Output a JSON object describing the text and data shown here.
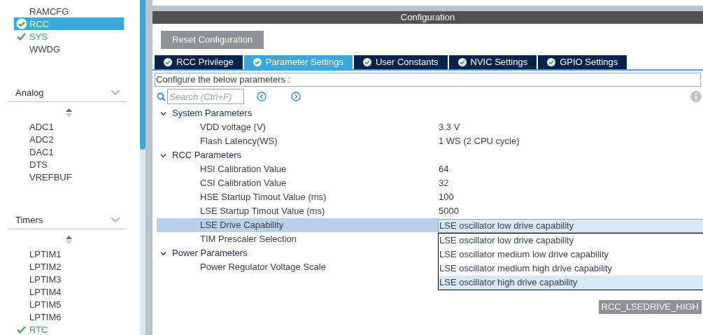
{
  "sidebar": {
    "groups": [
      {
        "items": [
          {
            "label": "RAMCFG",
            "selected": false,
            "checked": false
          },
          {
            "label": "RCC",
            "selected": true,
            "checked": true
          },
          {
            "label": "SYS",
            "selected": false,
            "checked": true
          },
          {
            "label": "WWDG",
            "selected": false,
            "checked": false
          }
        ]
      },
      {
        "title": "Analog",
        "items": [
          {
            "label": "ADC1",
            "selected": false,
            "checked": false
          },
          {
            "label": "ADC2",
            "selected": false,
            "checked": false
          },
          {
            "label": "DAC1",
            "selected": false,
            "checked": false
          },
          {
            "label": "DTS",
            "selected": false,
            "checked": false
          },
          {
            "label": "VREFBUF",
            "selected": false,
            "checked": false
          }
        ]
      },
      {
        "title": "Timers",
        "items": [
          {
            "label": "LPTIM1",
            "selected": false,
            "checked": false
          },
          {
            "label": "LPTIM2",
            "selected": false,
            "checked": false
          },
          {
            "label": "LPTIM3",
            "selected": false,
            "checked": false
          },
          {
            "label": "LPTIM4",
            "selected": false,
            "checked": false
          },
          {
            "label": "LPTIM5",
            "selected": false,
            "checked": false
          },
          {
            "label": "LPTIM6",
            "selected": false,
            "checked": false
          },
          {
            "label": "RTC",
            "selected": false,
            "checked": true
          }
        ]
      }
    ]
  },
  "panel": {
    "title": "Configuration",
    "reset_button": "Reset Configuration",
    "tabs": [
      {
        "label": "RCC Privilege",
        "selected": false
      },
      {
        "label": "Parameter Settings",
        "selected": true
      },
      {
        "label": "User Constants",
        "selected": false
      },
      {
        "label": "NVIC Settings",
        "selected": false
      },
      {
        "label": "GPIO Settings",
        "selected": false
      }
    ],
    "hint": "Configure the below parameters :",
    "search": {
      "placeholder": "Search (Ctrl+F)"
    },
    "tree": [
      {
        "label": "System Parameters",
        "expanded": true,
        "children": [
          {
            "name": "VDD voltage (V)",
            "value": "3.3 V",
            "selected": false
          },
          {
            "name": "Flash Latency(WS)",
            "value": "1 WS (2 CPU cycle)",
            "selected": false
          }
        ]
      },
      {
        "label": "RCC Parameters",
        "expanded": true,
        "children": [
          {
            "name": "HSI Calibration Value",
            "value": "64",
            "selected": false
          },
          {
            "name": "CSI Calibration Value",
            "value": "32",
            "selected": false
          },
          {
            "name": "HSE Startup Timout Value (ms)",
            "value": "100",
            "selected": false
          },
          {
            "name": "LSE Startup Timout Value (ms)",
            "value": "5000",
            "selected": false
          },
          {
            "name": "LSE Drive Capability",
            "selected": true
          },
          {
            "name": "TIM Prescaler Selection",
            "selected": false
          }
        ]
      },
      {
        "label": "Power Parameters",
        "expanded": true,
        "children": [
          {
            "name": "Power Regulator Voltage Scale",
            "selected": false
          }
        ]
      }
    ],
    "dropdown": {
      "value": "LSE oscillator low drive capability",
      "options": [
        {
          "label": "LSE oscillator low drive capability",
          "highlighted": false
        },
        {
          "label": "LSE oscillator medium low drive capability",
          "highlighted": false
        },
        {
          "label": "LSE oscillator medium high drive capability",
          "highlighted": false
        },
        {
          "label": "LSE oscillator high drive capability",
          "highlighted": true
        }
      ]
    },
    "tooltip": "RCC_LSEDRIVE_HIGH"
  }
}
